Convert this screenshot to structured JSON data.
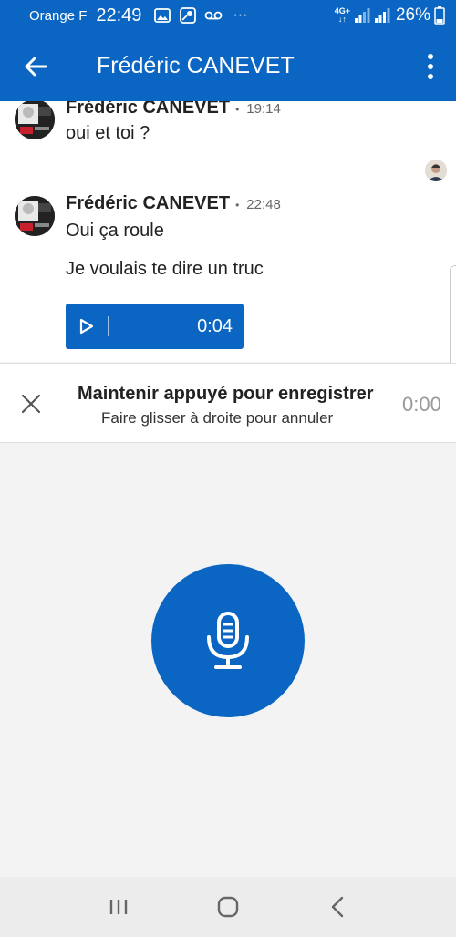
{
  "status_bar": {
    "carrier": "Orange F",
    "time": "22:49",
    "more": "···",
    "network_top": "4G+",
    "network_bottom": "↓↑",
    "battery": "26%"
  },
  "app_bar": {
    "title": "Frédéric CANEVET"
  },
  "messages": [
    {
      "name": "Frédéric CANEVET",
      "time": "19:14",
      "text": "oui et toi ?"
    },
    {
      "name": "Frédéric CANEVET",
      "time": "22:48",
      "text": "Oui ça roule",
      "text2": "Je voulais te dire un truc"
    }
  ],
  "audio": {
    "duration": "0:04"
  },
  "recording": {
    "hint_primary": "Maintenir appuyé pour enregistrer",
    "hint_secondary": "Faire glisser à droite pour annuler",
    "elapsed": "0:00"
  },
  "colors": {
    "accent": "#0a66c2",
    "background": "#f3f3f3"
  },
  "icons": {
    "back": "arrow-left-icon",
    "more": "more-vertical-icon",
    "play": "play-icon",
    "cancel": "close-icon",
    "mic": "microphone-icon",
    "nav_recent": "recent-apps-icon",
    "nav_home": "home-icon",
    "nav_back": "back-icon"
  }
}
